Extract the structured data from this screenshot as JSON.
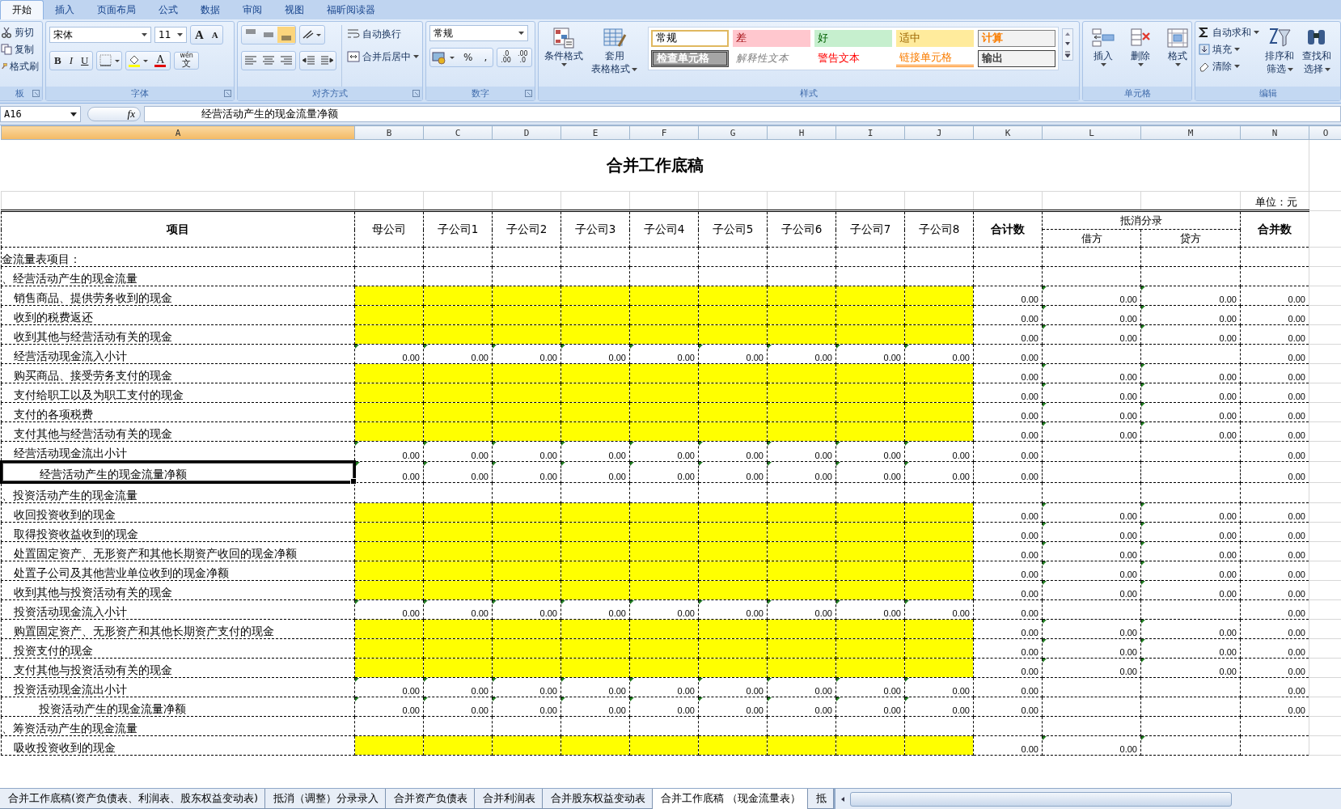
{
  "ribbon_tabs": [
    {
      "label": "开始",
      "selected": true
    },
    {
      "label": "插入",
      "selected": false
    },
    {
      "label": "页面布局",
      "selected": false
    },
    {
      "label": "公式",
      "selected": false
    },
    {
      "label": "数据",
      "selected": false
    },
    {
      "label": "审阅",
      "selected": false
    },
    {
      "label": "视图",
      "selected": false
    },
    {
      "label": "福昕阅读器",
      "selected": false
    }
  ],
  "clipboard": {
    "items": [
      {
        "label": "剪切",
        "kind": "cut"
      },
      {
        "label": "复制",
        "kind": "copy"
      },
      {
        "label": "格式刷",
        "kind": "brush"
      }
    ],
    "group_label": "板"
  },
  "font": {
    "name": "宋体",
    "size": "11",
    "grow": "A",
    "shrink": "A",
    "bold": "B",
    "italic": "I",
    "underline": "U",
    "color_glyph": "A",
    "phonetic": [
      "wén",
      "文"
    ],
    "group_label": "字体"
  },
  "alignment": {
    "wrap": "自动换行",
    "merge": "合并后居中",
    "group_label": "对齐方式"
  },
  "number": {
    "format": "常规",
    "percent": "%",
    "comma": ",",
    "decimals": [
      [
        ".0",
        ".00"
      ],
      [
        ".00",
        ".0"
      ]
    ],
    "group_label": "数字"
  },
  "styles": {
    "conditional": "条件格式",
    "table_format": [
      "套用",
      "表格格式"
    ],
    "group_label": "样式",
    "cells": [
      {
        "label": "常规",
        "kind": "normal"
      },
      {
        "label": "差",
        "kind": "bad"
      },
      {
        "label": "好",
        "kind": "good"
      },
      {
        "label": "适中",
        "kind": "neutral"
      },
      {
        "label": "计算",
        "kind": "calc"
      },
      {
        "label": "检查单元格",
        "kind": "check"
      },
      {
        "label": "解释性文本",
        "kind": "explanatory"
      },
      {
        "label": "警告文本",
        "kind": "warning"
      },
      {
        "label": "链接单元格",
        "kind": "linked"
      },
      {
        "label": "输出",
        "kind": "output"
      }
    ]
  },
  "cells_group": {
    "buttons": [
      {
        "label": "插入",
        "kind": "insert"
      },
      {
        "label": "删除",
        "kind": "delete"
      },
      {
        "label": "格式",
        "kind": "format"
      }
    ],
    "group_label": "单元格"
  },
  "editing": {
    "items": [
      {
        "label": "自动求和",
        "kind": "sum"
      },
      {
        "label": "填充",
        "kind": "fill"
      },
      {
        "label": "清除",
        "kind": "clear"
      }
    ],
    "sort": [
      "排序和",
      "筛选"
    ],
    "find": [
      "查找和",
      "选择"
    ],
    "group_label": "编辑"
  },
  "formula_bar": {
    "name_box": "A16",
    "fx": "fx",
    "content": "经营活动产生的现金流量净额"
  },
  "columns": [
    {
      "letter": "A",
      "selected": true
    },
    {
      "letter": "B",
      "selected": false
    },
    {
      "letter": "C",
      "selected": false
    },
    {
      "letter": "D",
      "selected": false
    },
    {
      "letter": "E",
      "selected": false
    },
    {
      "letter": "F",
      "selected": false
    },
    {
      "letter": "G",
      "selected": false
    },
    {
      "letter": "H",
      "selected": false
    },
    {
      "letter": "I",
      "selected": false
    },
    {
      "letter": "J",
      "selected": false
    },
    {
      "letter": "K",
      "selected": false
    },
    {
      "letter": "L",
      "selected": false
    },
    {
      "letter": "M",
      "selected": false
    },
    {
      "letter": "N",
      "selected": false
    },
    {
      "letter": "O",
      "selected": false
    }
  ],
  "sheet": {
    "title": "合并工作底稿",
    "unit": "单位：元",
    "item_header": "项目",
    "companies": [
      "母公司",
      "子公司1",
      "子公司2",
      "子公司3",
      "子公司4",
      "子公司5",
      "子公司6",
      "子公司7",
      "子公司8"
    ],
    "total_header": "合计数",
    "elimination_header": "抵消分录",
    "debit_header": "借方",
    "credit_header": "贷方",
    "merged_header": "合并数"
  },
  "rows": [
    {
      "label": "金流量表项目：",
      "kind": "section",
      "selected": false
    },
    {
      "label": "、经营活动产生的现金流量",
      "kind": "section",
      "selected": false
    },
    {
      "label": "销售商品、提供劳务收到的现金",
      "kind": "input",
      "selected": false,
      "total": "0.00",
      "debit": "0.00",
      "credit": "0.00",
      "merged": "0.00"
    },
    {
      "label": "收到的税费返还",
      "kind": "input",
      "selected": false,
      "total": "0.00",
      "debit": "0.00",
      "credit": "0.00",
      "merged": "0.00"
    },
    {
      "label": "收到其他与经营活动有关的现金",
      "kind": "input",
      "selected": false,
      "total": "0.00",
      "debit": "0.00",
      "credit": "0.00",
      "merged": "0.00"
    },
    {
      "label": "经营活动现金流入小计",
      "kind": "subtotal",
      "selected": false,
      "companies": [
        "0.00",
        "0.00",
        "0.00",
        "0.00",
        "0.00",
        "0.00",
        "0.00",
        "0.00",
        "0.00"
      ],
      "total": "0.00",
      "merged": "0.00"
    },
    {
      "label": "购买商品、接受劳务支付的现金",
      "kind": "input",
      "selected": false,
      "total": "0.00",
      "debit": "0.00",
      "credit": "0.00",
      "merged": "0.00"
    },
    {
      "label": "支付给职工以及为职工支付的现金",
      "kind": "input",
      "selected": false,
      "total": "0.00",
      "debit": "0.00",
      "credit": "0.00",
      "merged": "0.00"
    },
    {
      "label": "支付的各项税费",
      "kind": "input",
      "selected": false,
      "total": "0.00",
      "debit": "0.00",
      "credit": "0.00",
      "merged": "0.00"
    },
    {
      "label": "支付其他与经营活动有关的现金",
      "kind": "input",
      "selected": false,
      "total": "0.00",
      "debit": "0.00",
      "credit": "0.00",
      "merged": "0.00"
    },
    {
      "label": "经营活动现金流出小计",
      "kind": "subtotal",
      "selected": false,
      "companies": [
        "0.00",
        "0.00",
        "0.00",
        "0.00",
        "0.00",
        "0.00",
        "0.00",
        "0.00",
        "0.00"
      ],
      "total": "0.00",
      "merged": "0.00"
    },
    {
      "label": "经营活动产生的现金流量净额",
      "kind": "net",
      "selected": true,
      "companies": [
        "0.00",
        "0.00",
        "0.00",
        "0.00",
        "0.00",
        "0.00",
        "0.00",
        "0.00",
        "0.00"
      ],
      "total": "0.00",
      "merged": "0.00"
    },
    {
      "label": "、投资活动产生的现金流量",
      "kind": "section",
      "selected": false
    },
    {
      "label": "收回投资收到的现金",
      "kind": "input",
      "selected": false,
      "total": "0.00",
      "debit": "0.00",
      "credit": "0.00",
      "merged": "0.00"
    },
    {
      "label": "取得投资收益收到的现金",
      "kind": "input",
      "selected": false,
      "total": "0.00",
      "debit": "0.00",
      "credit": "0.00",
      "merged": "0.00"
    },
    {
      "label": "处置固定资产、无形资产和其他长期资产收回的现金净额",
      "kind": "input",
      "selected": false,
      "total": "0.00",
      "debit": "0.00",
      "credit": "0.00",
      "merged": "0.00"
    },
    {
      "label": "处置子公司及其他营业单位收到的现金净额",
      "kind": "input",
      "selected": false,
      "total": "0.00",
      "debit": "0.00",
      "credit": "0.00",
      "merged": "0.00"
    },
    {
      "label": "收到其他与投资活动有关的现金",
      "kind": "input",
      "selected": false,
      "total": "0.00",
      "debit": "0.00",
      "credit": "0.00",
      "merged": "0.00"
    },
    {
      "label": "投资活动现金流入小计",
      "kind": "subtotal",
      "selected": false,
      "companies": [
        "0.00",
        "0.00",
        "0.00",
        "0.00",
        "0.00",
        "0.00",
        "0.00",
        "0.00",
        "0.00"
      ],
      "total": "0.00",
      "merged": "0.00"
    },
    {
      "label": "购置固定资产、无形资产和其他长期资产支付的现金",
      "kind": "input",
      "selected": false,
      "total": "0.00",
      "debit": "0.00",
      "credit": "0.00",
      "merged": "0.00"
    },
    {
      "label": "投资支付的现金",
      "kind": "input",
      "selected": false,
      "total": "0.00",
      "debit": "0.00",
      "credit": "0.00",
      "merged": "0.00"
    },
    {
      "label": "支付其他与投资活动有关的现金",
      "kind": "input",
      "selected": false,
      "total": "0.00",
      "debit": "0.00",
      "credit": "0.00",
      "merged": "0.00"
    },
    {
      "label": "投资活动现金流出小计",
      "kind": "subtotal",
      "selected": false,
      "companies": [
        "0.00",
        "0.00",
        "0.00",
        "0.00",
        "0.00",
        "0.00",
        "0.00",
        "0.00",
        "0.00"
      ],
      "total": "0.00",
      "merged": "0.00"
    },
    {
      "label": "投资活动产生的现金流量净额",
      "kind": "net",
      "selected": false,
      "companies": [
        "0.00",
        "0.00",
        "0.00",
        "0.00",
        "0.00",
        "0.00",
        "0.00",
        "0.00",
        "0.00"
      ],
      "total": "0.00",
      "merged": "0.00"
    },
    {
      "label": "、筹资活动产生的现金流量",
      "kind": "section",
      "selected": false
    },
    {
      "label": "吸收投资收到的现金",
      "kind": "input",
      "selected": false,
      "total": "0.00",
      "debit": "0.00"
    }
  ],
  "sheet_tabs": [
    {
      "label": "合并工作底稿(资产负债表、利润表、股东权益变动表)",
      "selected": false
    },
    {
      "label": "抵消（调整）分录录入",
      "selected": false
    },
    {
      "label": "合并资产负债表",
      "selected": false
    },
    {
      "label": "合并利润表",
      "selected": false
    },
    {
      "label": "合并股东权益变动表",
      "selected": false
    },
    {
      "label": "合并工作底稿 （现金流量表）",
      "selected": true
    },
    {
      "label": "抵",
      "selected": false
    }
  ]
}
